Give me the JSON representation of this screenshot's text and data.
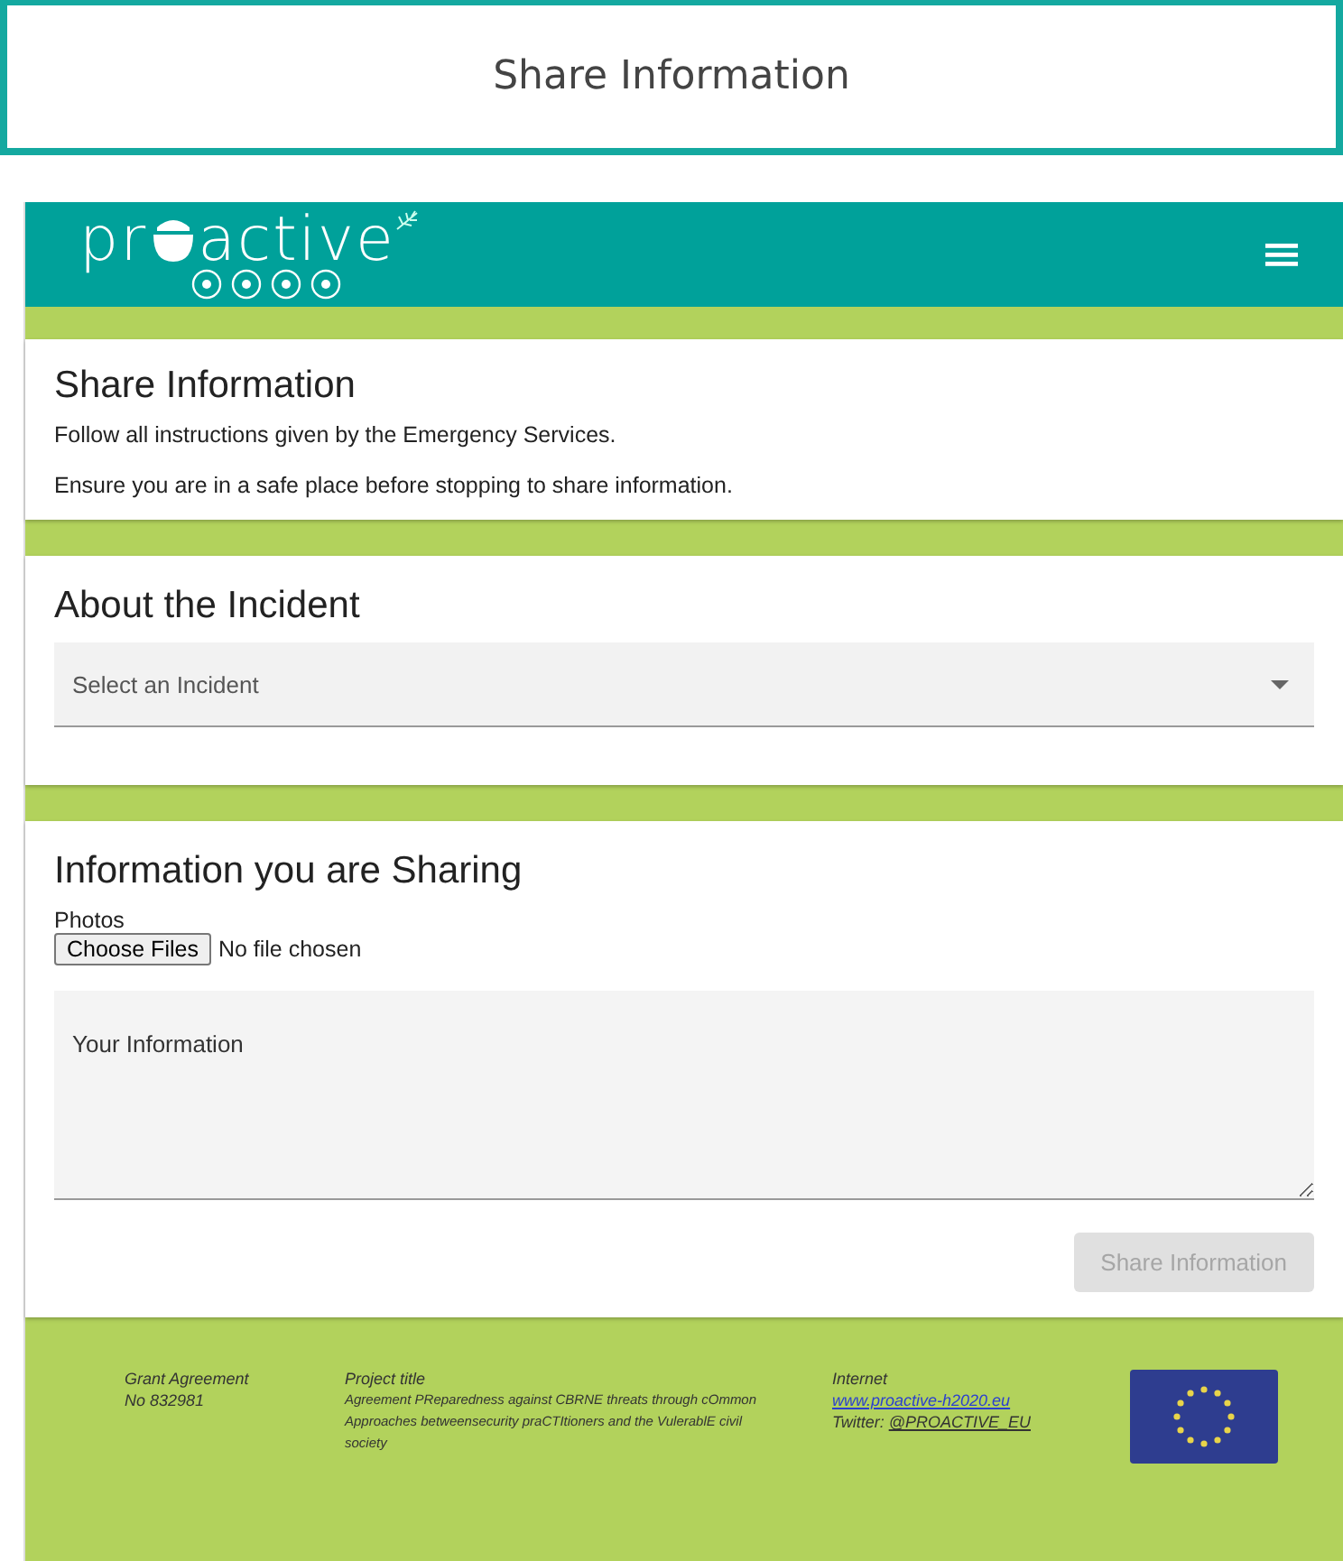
{
  "banner": {
    "title": "Share Information"
  },
  "header": {
    "logo_start": "pr",
    "logo_end": "active"
  },
  "intro": {
    "title": "Share Information",
    "lines": [
      "Follow all instructions given by the Emergency Services.",
      "Ensure you are in a safe place before stopping to share information."
    ]
  },
  "incident": {
    "title": "About the Incident",
    "select": {
      "placeholder": "Select an Incident"
    }
  },
  "sharing": {
    "title": "Information you are Sharing",
    "photos_label": "Photos",
    "file_button": "Choose Files",
    "file_status": "No file chosen",
    "textarea": {
      "placeholder": "Your Information"
    },
    "submit": {
      "label": "Share Information",
      "disabled": true
    }
  },
  "footer": {
    "grant": [
      "Grant Agreement",
      "No 832981"
    ],
    "project_label": "Project title",
    "project_text": "Agreement PReparedness against CBRNE threats through cOmmon Approaches betweensecurity praCTItioners and the VulerablE civil society",
    "internet_label": "Internet",
    "website": "www.proactive-h2020.eu",
    "twitter_label": "Twitter: ",
    "twitter_handle": "@PROACTIVE_EU"
  }
}
